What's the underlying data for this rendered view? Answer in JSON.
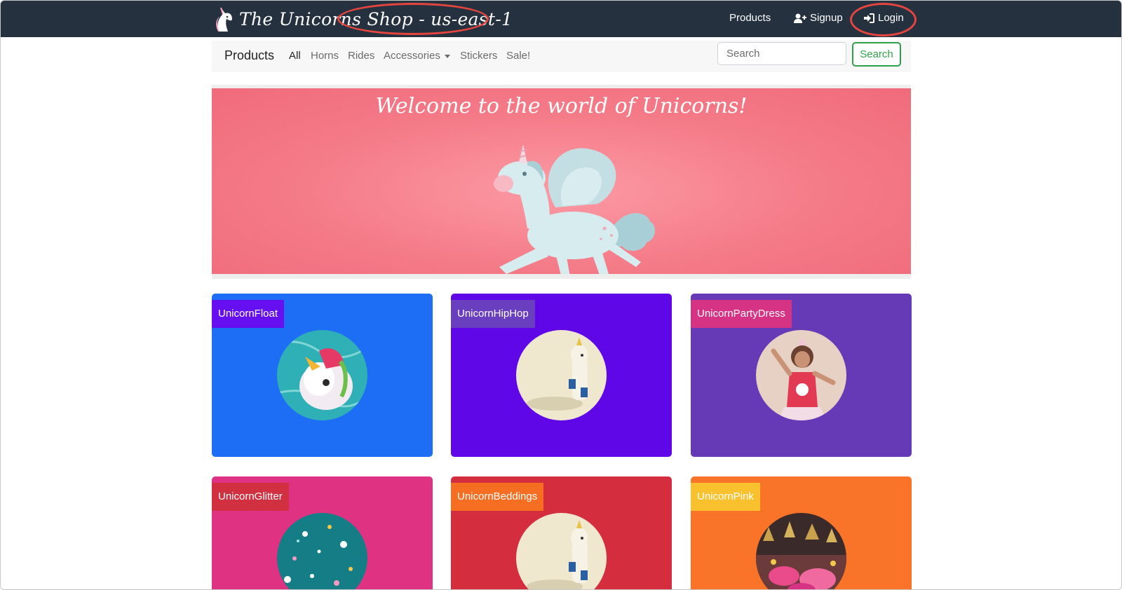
{
  "header": {
    "brand": "The Unicorns Shop - us-east-1",
    "nav": {
      "products": "Products",
      "signup": "Signup",
      "login": "Login"
    }
  },
  "subnav": {
    "title": "Products",
    "links": [
      "All",
      "Horns",
      "Rides",
      "Accessories",
      "Stickers",
      "Sale!"
    ],
    "search_placeholder": "Search",
    "search_button": "Search"
  },
  "hero": {
    "title": "Welcome to the world of Unicorns!"
  },
  "products": [
    {
      "name": "UnicornFloat",
      "card_color": "#1e6ef5",
      "label_color": "#6610f2"
    },
    {
      "name": "UnicornHipHop",
      "card_color": "#5f07e7",
      "label_color": "#6a3fbf"
    },
    {
      "name": "UnicornPartyDress",
      "card_color": "#6639b6",
      "label_color": "#d63384"
    },
    {
      "name": "UnicornGlitter",
      "card_color": "#df3282",
      "label_color": "#d0303f"
    },
    {
      "name": "UnicornBeddings",
      "card_color": "#d32d3e",
      "label_color": "#f66e22"
    },
    {
      "name": "UnicornPink",
      "card_color": "#f97429",
      "label_color": "#f8c12d"
    }
  ],
  "colors": {
    "navbar": "#263140",
    "annotation": "#e5453e",
    "search_green": "#2fa148",
    "hero_pink": "#f47a87"
  }
}
